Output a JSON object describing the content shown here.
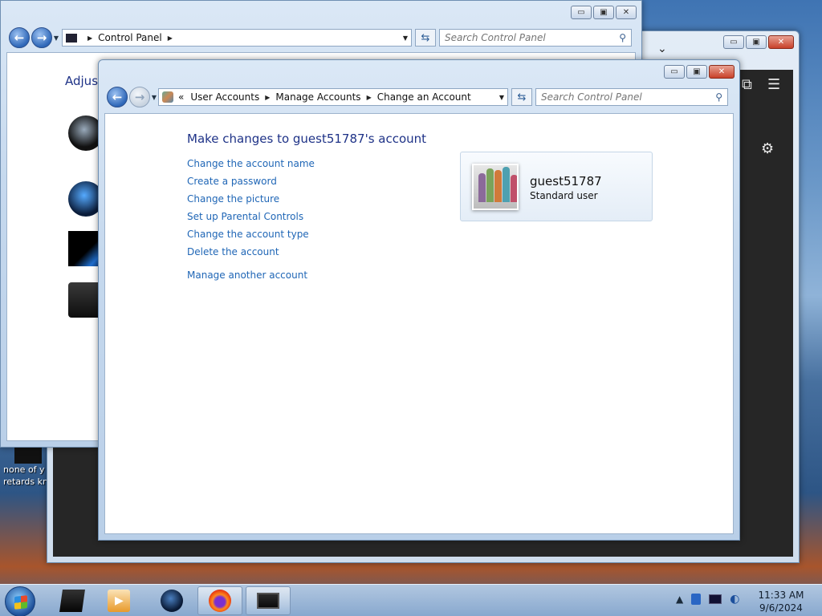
{
  "desktop": {
    "icon_caption_line1": "none of y",
    "icon_caption_line2": "retards kn"
  },
  "back_window": {
    "breadcrumb": [
      "Control Panel"
    ],
    "search_placeholder": "Search Control Panel",
    "adjust_text": "Adjust"
  },
  "front_window": {
    "breadcrumb": [
      "User Accounts",
      "Manage Accounts",
      "Change an Account"
    ],
    "breadcrumb_prefix": "«",
    "search_placeholder": "Search Control Panel",
    "heading": "Make changes to guest51787's account",
    "tasks": [
      "Change the account name",
      "Create a password",
      "Change the picture",
      "Set up Parental Controls",
      "Change the account type",
      "Delete the account"
    ],
    "other_link": "Manage another account",
    "account": {
      "name": "guest51787",
      "type": "Standard user"
    }
  },
  "caption_buttons": {
    "minimize": "▭",
    "maximize": "▣",
    "close": "✕"
  },
  "taskbar": {
    "time": "11:33 AM",
    "date": "9/6/2024"
  },
  "colors": {
    "link": "#1f66b6",
    "heading": "#1e3287",
    "taskbar": "#a9c3e2"
  }
}
